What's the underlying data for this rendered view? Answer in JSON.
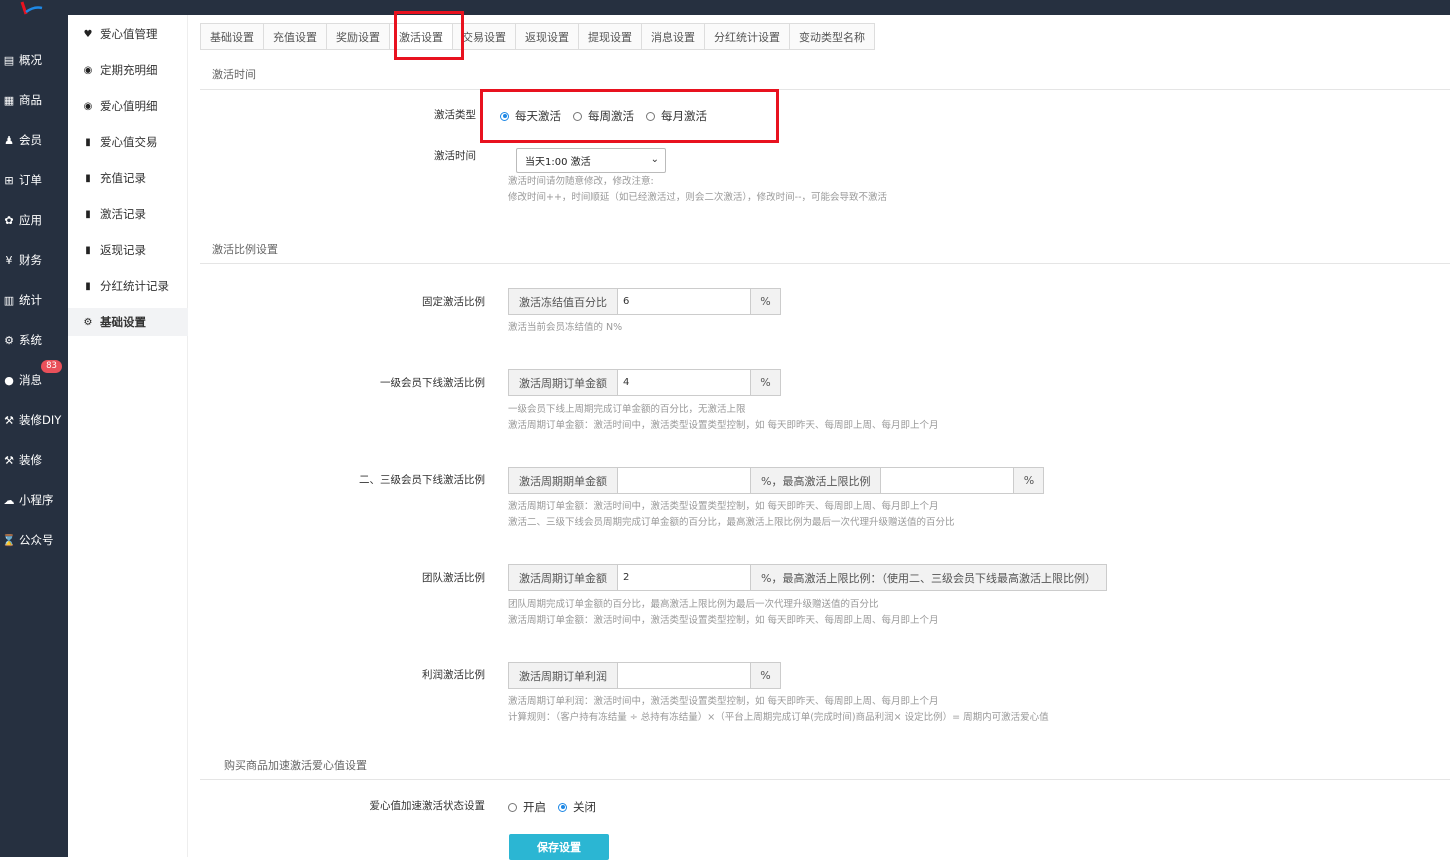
{
  "rail": {
    "items": [
      {
        "label": "概况",
        "icon": "dashboard-icon"
      },
      {
        "label": "商品",
        "icon": "goods-icon"
      },
      {
        "label": "会员",
        "icon": "users-icon"
      },
      {
        "label": "订单",
        "icon": "cart-icon"
      },
      {
        "label": "应用",
        "icon": "apps-icon"
      },
      {
        "label": "财务",
        "icon": "yen-icon"
      },
      {
        "label": "统计",
        "icon": "bar-chart-icon"
      },
      {
        "label": "系统",
        "icon": "gears-icon"
      },
      {
        "label": "消息",
        "icon": "chat-icon"
      },
      {
        "label": "装修DIY",
        "icon": "hammer-icon"
      },
      {
        "label": "装修",
        "icon": "hammer-icon"
      },
      {
        "label": "小程序",
        "icon": "wechat-icon"
      },
      {
        "label": "公众号",
        "icon": "hourglass-icon"
      }
    ],
    "message_badge": "83"
  },
  "subnav": {
    "items": [
      {
        "label": "爱心值管理",
        "icon": "heart-icon"
      },
      {
        "label": "定期充明细",
        "icon": "circle-dot-icon"
      },
      {
        "label": "爱心值明细",
        "icon": "circle-heart-icon"
      },
      {
        "label": "爱心值交易",
        "icon": "document-icon"
      },
      {
        "label": "充值记录",
        "icon": "document-icon"
      },
      {
        "label": "激活记录",
        "icon": "document-icon"
      },
      {
        "label": "返现记录",
        "icon": "document-icon"
      },
      {
        "label": "分红统计记录",
        "icon": "document-icon"
      },
      {
        "label": "基础设置",
        "icon": "gears-icon"
      }
    ],
    "active": "基础设置"
  },
  "tabs": [
    "基础设置",
    "充值设置",
    "奖励设置",
    "激活设置",
    "交易设置",
    "返现设置",
    "提现设置",
    "消息设置",
    "分红统计设置",
    "变动类型名称"
  ],
  "active_tab": "激活设置",
  "section1": {
    "title": "激活时间",
    "type_label": "激活类型",
    "type_options": [
      "每天激活",
      "每周激活",
      "每月激活"
    ],
    "type_selected": "每天激活",
    "time_label": "激活时间",
    "time_value": "当天1:00 激活",
    "help1": "激活时间请勿随意修改，修改注意:",
    "help2": "修改时间++，时间顺延（如已经激活过，则会二次激活），修改时间--，可能会导致不激活"
  },
  "section2": {
    "title": "激活比例设置",
    "fixed": {
      "label": "固定激活比例",
      "addon": "激活冻结值百分比",
      "value": "6",
      "unit": "%",
      "help": "激活当前会员冻结值的 N%"
    },
    "level1": {
      "label": "一级会员下线激活比例",
      "addon": "激活周期订单金额",
      "value": "4",
      "unit": "%",
      "help1": "一级会员下线上周期完成订单金额的百分比，无激活上限",
      "help2": "激活周期订单金额：激活时间中，激活类型设置类型控制，如 每天即昨天、每周即上周、每月即上个月"
    },
    "level23": {
      "label": "二、三级会员下线激活比例",
      "addon": "激活周期期单金额",
      "value": "",
      "mid": "%，最高激活上限比例",
      "value2": "",
      "unit": "%",
      "help1": "激活周期订单金额：激活时间中，激活类型设置类型控制，如 每天即昨天、每周即上周、每月即上个月",
      "help2": "激活二、三级下线会员周期完成订单金额的百分比，最高激活上限比例为最后一次代理升级赠送值的百分比"
    },
    "team": {
      "label": "团队激活比例",
      "addon": "激活周期订单金额",
      "value": "2",
      "tail": "%，最高激活上限比例：（使用二、三级会员下线最高激活上限比例）",
      "help1": "团队周期完成订单金额的百分比，最高激活上限比例为最后一次代理升级赠送值的百分比",
      "help2": "激活周期订单金额：激活时间中，激活类型设置类型控制，如 每天即昨天、每周即上周、每月即上个月"
    },
    "profit": {
      "label": "利润激活比例",
      "addon": "激活周期订单利润",
      "value": "",
      "unit": "%",
      "help1": "激活周期订单利润：激活时间中，激活类型设置类型控制，如 每天即昨天、每周即上周、每月即上个月",
      "help2": "计算规则：（客户持有冻结量 ÷ 总持有冻结量）×（平台上周期完成订单(完成时间)商品利润× 设定比例）= 周期内可激活爱心值"
    }
  },
  "section3": {
    "title": "购买商品加速激活爱心值设置",
    "label": "爱心值加速激活状态设置",
    "options": [
      "开启",
      "关闭"
    ],
    "selected": "关闭"
  },
  "save_label": "保存设置"
}
